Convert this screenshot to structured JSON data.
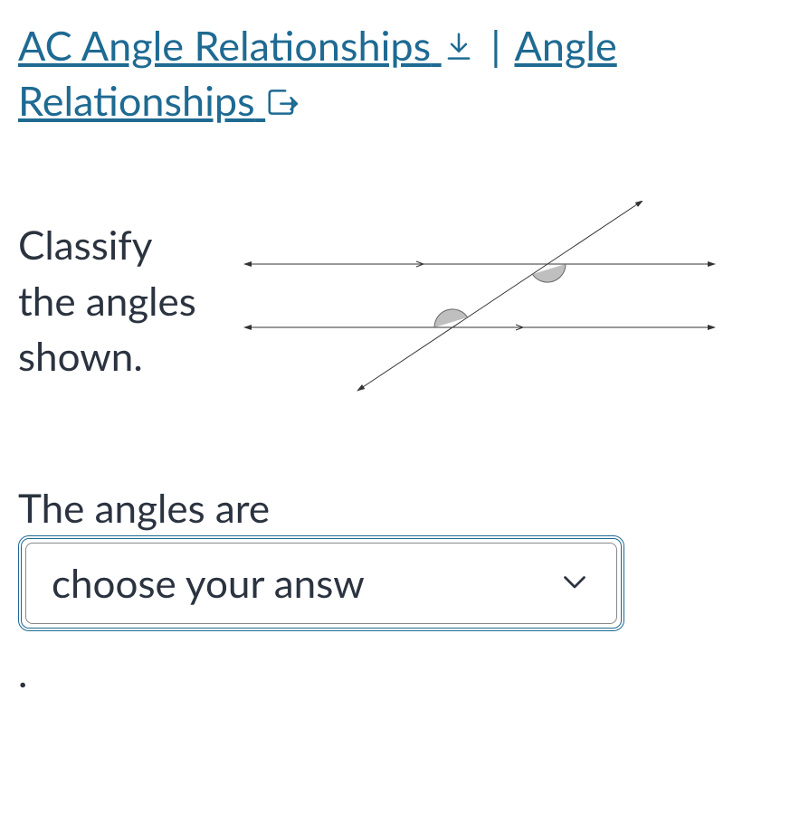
{
  "header": {
    "link1": "AC Angle Relationships",
    "separator": "|",
    "link2": "Angle Relationships"
  },
  "question": {
    "prompt": "Classify the angles shown."
  },
  "answer": {
    "lead": "The angles are",
    "placeholder": "choose your answ",
    "trail": "."
  }
}
